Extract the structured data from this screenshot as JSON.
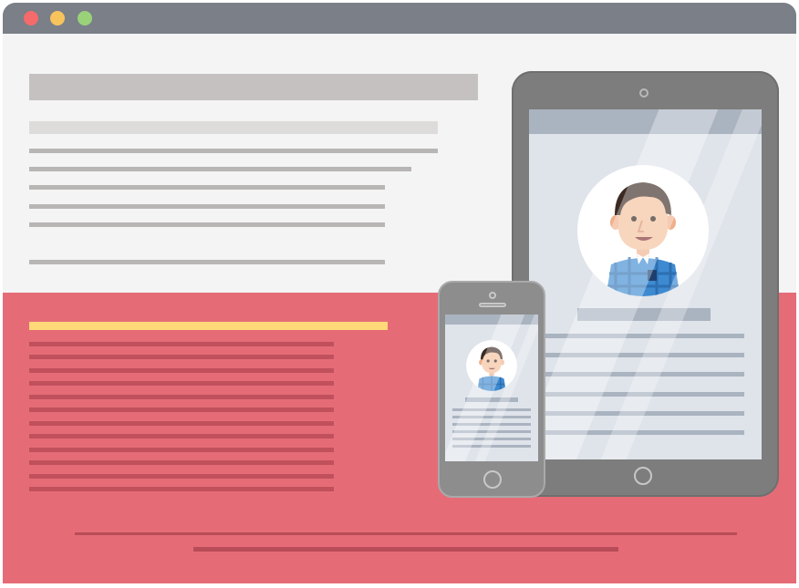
{
  "window": {
    "controls": [
      "close",
      "minimize",
      "maximize"
    ]
  },
  "colors": {
    "titlebar": "#7a7f88",
    "page_background": "#f4f4f4",
    "accent_section": "#e56c77",
    "highlight_bar": "#ffd878",
    "device_body": "#7d7d7d",
    "screen_background": "#dfe3ea"
  },
  "illustration": {
    "devices": [
      "tablet",
      "phone"
    ],
    "avatar": "person-avatar-icon"
  }
}
